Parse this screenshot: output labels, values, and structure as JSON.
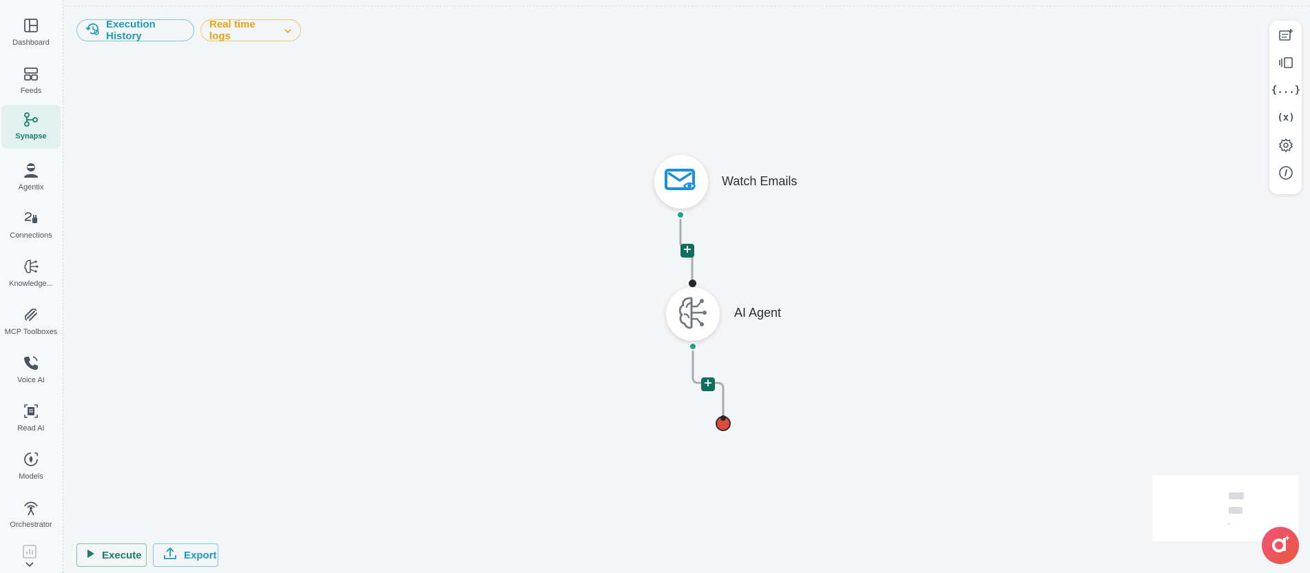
{
  "sidebar": {
    "items": [
      {
        "label": "Dashboard",
        "icon": "dashboard-icon",
        "active": false
      },
      {
        "label": "Feeds",
        "icon": "feeds-icon",
        "active": false
      },
      {
        "label": "Synapse",
        "icon": "synapse-icon",
        "active": true
      },
      {
        "label": "Agentix",
        "icon": "agent-icon",
        "active": false
      },
      {
        "label": "Connections",
        "icon": "plug-icon",
        "active": false
      },
      {
        "label": "Knowledge...",
        "icon": "brain-icon",
        "active": false
      },
      {
        "label": "MCP Toolboxes",
        "icon": "toolbox-icon",
        "active": false
      },
      {
        "label": "Voice AI",
        "icon": "phone-icon",
        "active": false
      },
      {
        "label": "Read AI",
        "icon": "document-icon",
        "active": false
      },
      {
        "label": "Models",
        "icon": "models-icon",
        "active": false
      },
      {
        "label": "Orchestrator",
        "icon": "antenna-icon",
        "active": false
      }
    ]
  },
  "toolbar": {
    "execution_history_label": "Execution History",
    "realtime_logs_label": "Real time logs"
  },
  "right_tools": {
    "items": [
      "add-note-icon",
      "panel-icon",
      "json-braces-icon",
      "variables-icon",
      "settings-icon",
      "info-icon"
    ],
    "json_label": "{...}",
    "variables_label": "(x)"
  },
  "flow": {
    "nodes": [
      {
        "label": "Watch Emails",
        "icon": "email-watch-icon"
      },
      {
        "label": "AI Agent",
        "icon": "ai-brain-icon"
      }
    ]
  },
  "footer": {
    "execute_label": "Execute",
    "export_label": "Export"
  },
  "colors": {
    "accent_green": "#14806b",
    "accent_teal": "#1b9cb8",
    "accent_orange": "#e8a313",
    "add_button": "#0f6e5d",
    "end_node": "#e04a3a"
  }
}
